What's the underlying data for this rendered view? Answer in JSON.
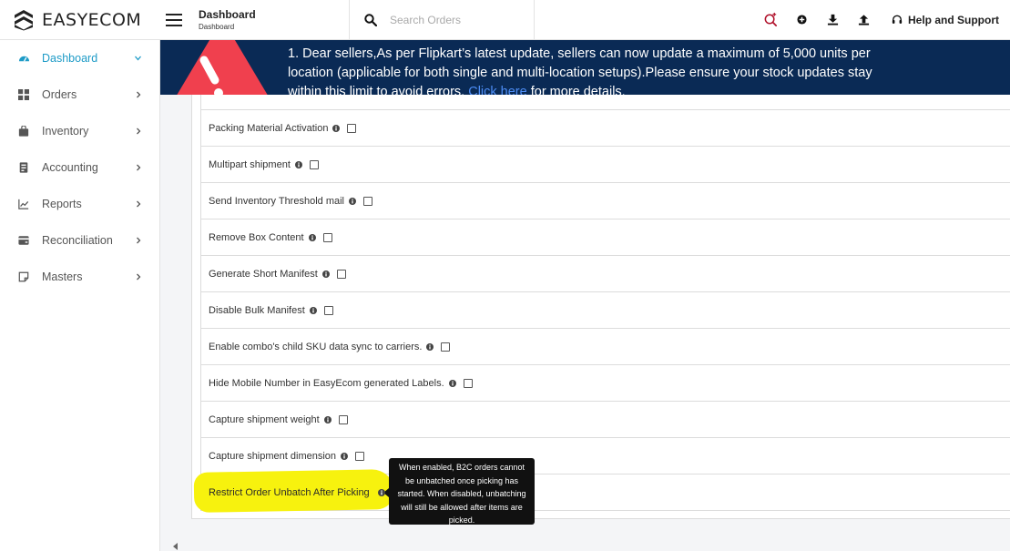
{
  "app": {
    "name": "EASYECOM"
  },
  "header": {
    "title": "Dashboard",
    "subtitle": "Dashboard",
    "search_placeholder": "Search Orders",
    "help_label": "Help and Support"
  },
  "sidebar": {
    "items": [
      {
        "label": "Dashboard",
        "icon": "dashboard-icon",
        "active": true
      },
      {
        "label": "Orders",
        "icon": "orders-icon"
      },
      {
        "label": "Inventory",
        "icon": "inventory-icon"
      },
      {
        "label": "Accounting",
        "icon": "accounting-icon"
      },
      {
        "label": "Reports",
        "icon": "reports-icon"
      },
      {
        "label": "Reconciliation",
        "icon": "reconciliation-icon"
      },
      {
        "label": "Masters",
        "icon": "masters-icon"
      }
    ]
  },
  "banner": {
    "text_before_link": "1. Dear sellers,As per Flipkart’s latest update, sellers can now update a maximum of 5,000 units per location (applicable for both single and multi-location setups).Please ensure your stock updates stay within this limit to avoid errors.",
    "link": "Click here",
    "text_after_link": " for more details."
  },
  "settings": [
    {
      "label": "Packing Material Activation"
    },
    {
      "label": "Multipart shipment"
    },
    {
      "label": "Send Inventory Threshold mail"
    },
    {
      "label": "Remove Box Content"
    },
    {
      "label": "Generate Short Manifest"
    },
    {
      "label": "Disable Bulk Manifest"
    },
    {
      "label": "Enable combo's child SKU data sync to carriers."
    },
    {
      "label": "Hide Mobile Number in EasyEcom generated Labels."
    },
    {
      "label": "Capture shipment weight"
    },
    {
      "label": "Capture shipment dimension"
    },
    {
      "label": "Restrict Order Unbatch After Picking"
    }
  ],
  "tooltip": "When enabled, B2C orders cannot be unbatched once picking has started. When disabled, unbatching will still be allowed after items are picked.",
  "colors": {
    "accent": "#1e9bc7",
    "banner_bg": "#0a2a55",
    "highlight": "#f7f20e"
  }
}
